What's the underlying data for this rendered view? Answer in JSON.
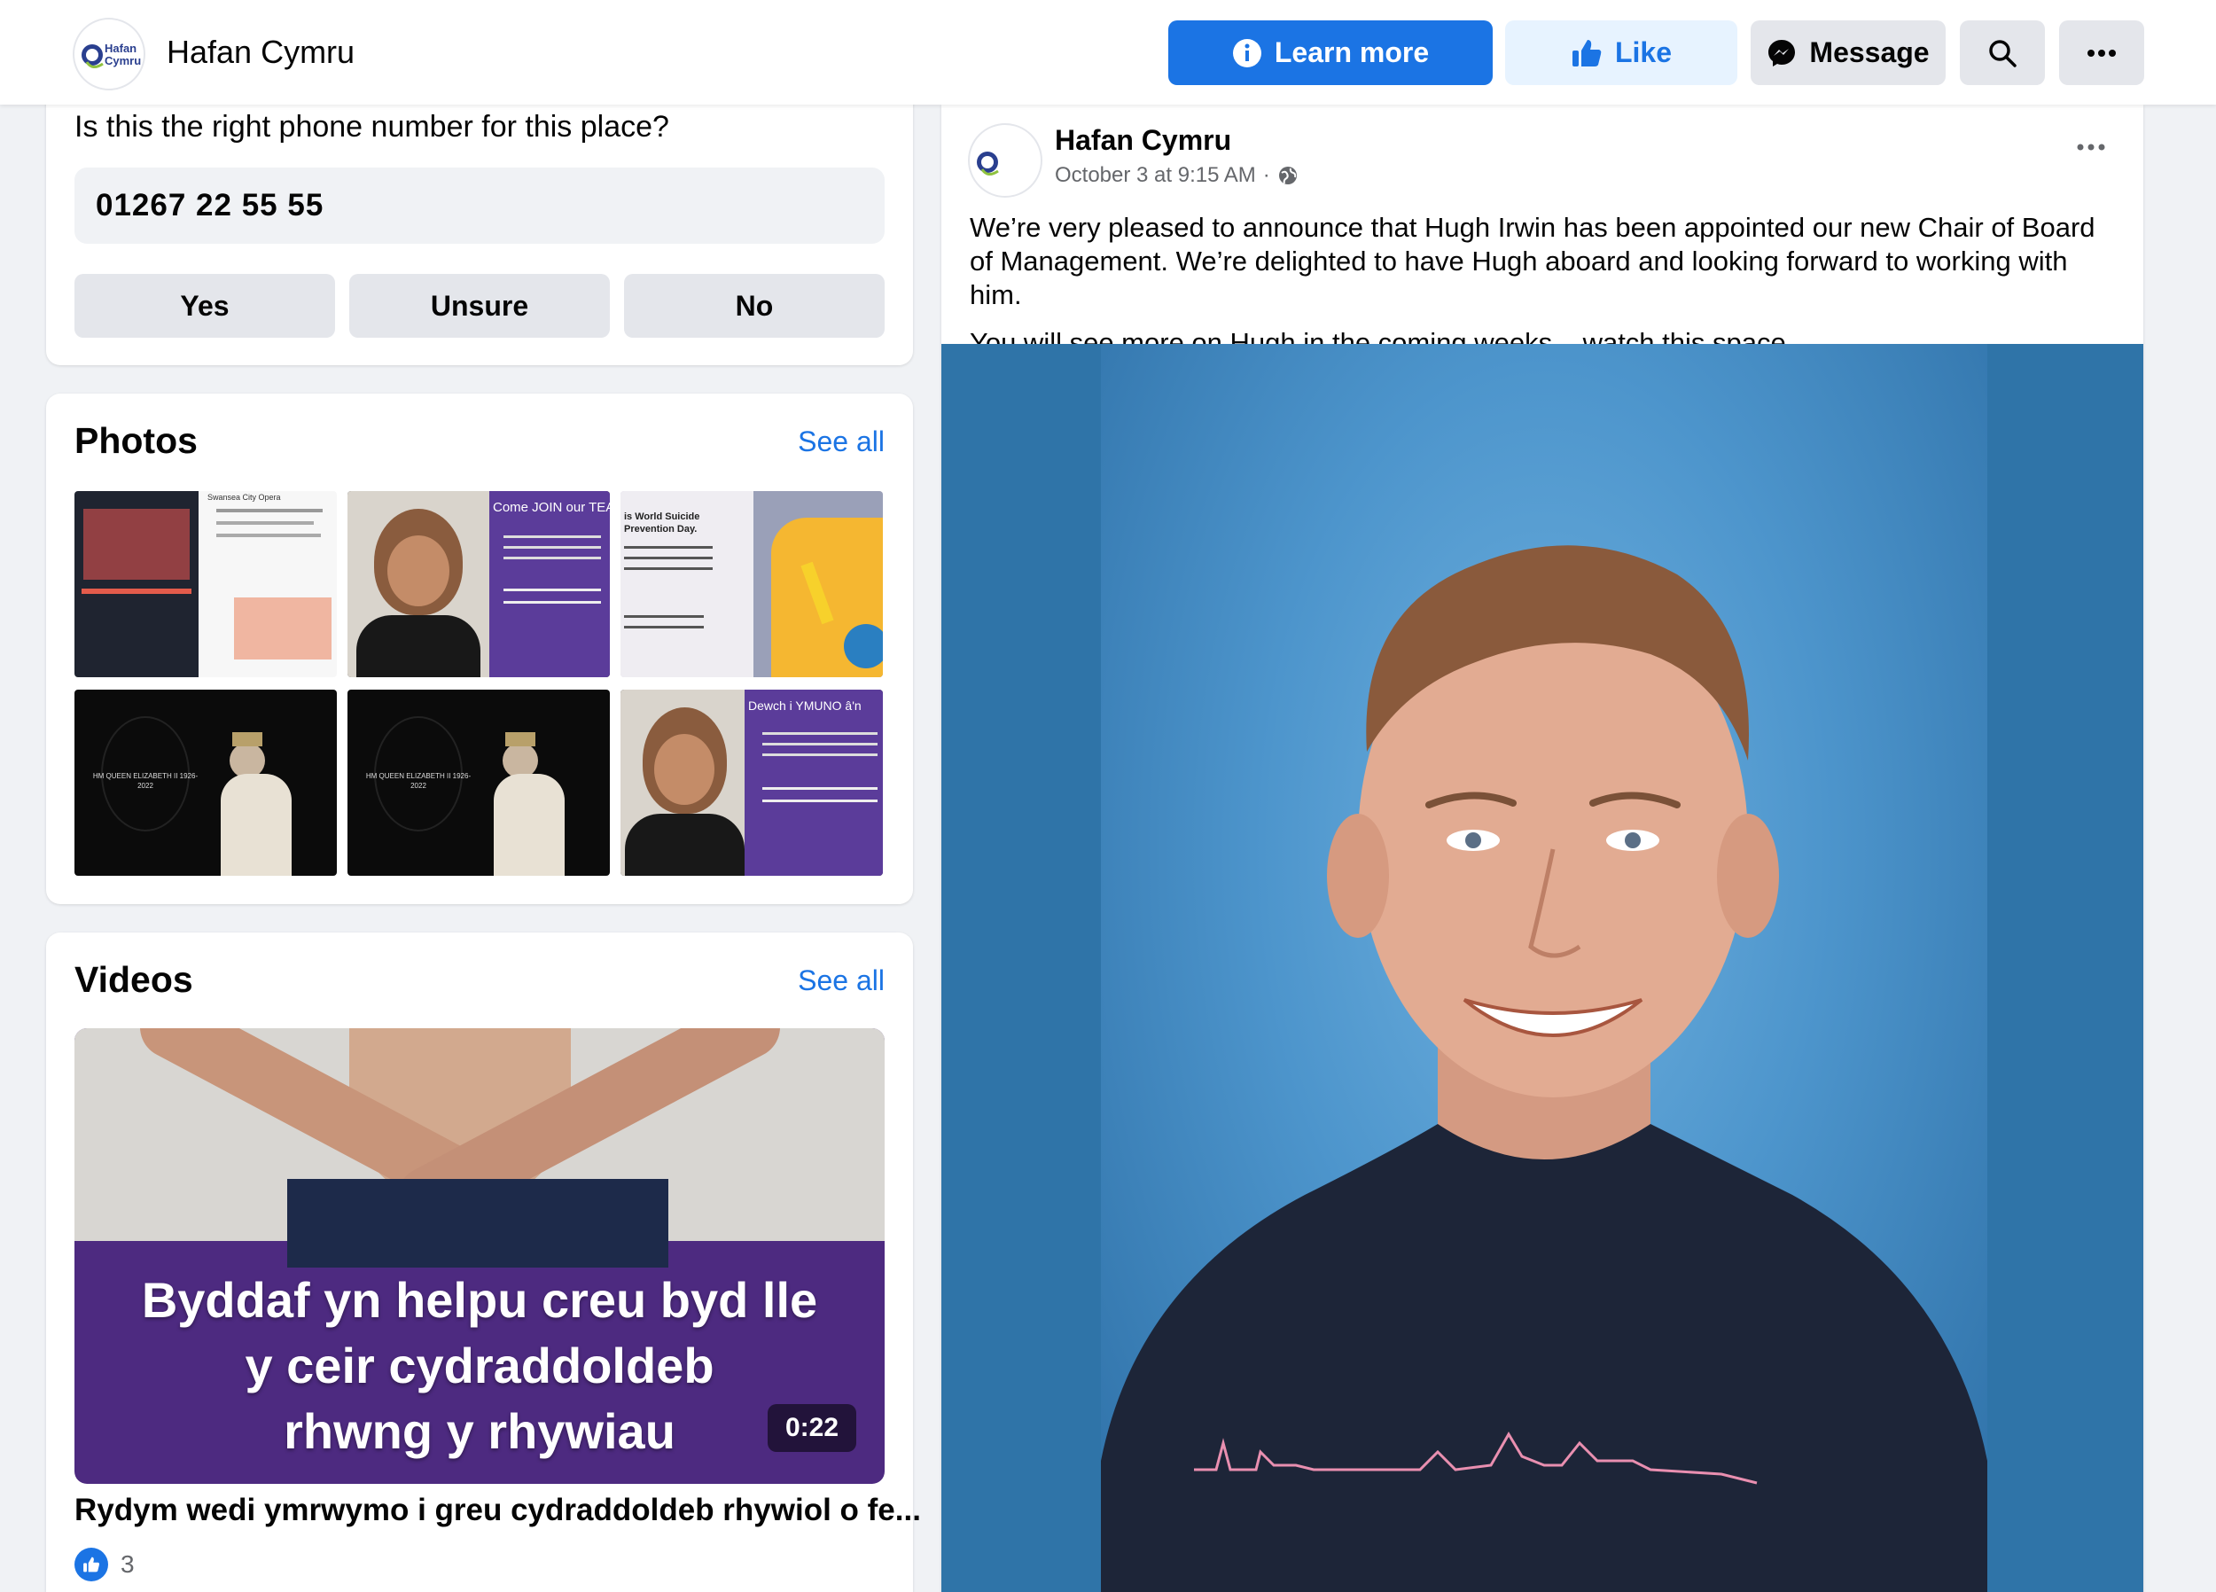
{
  "header": {
    "page_name": "Hafan Cymru",
    "logo_text": "Hafan Cymru",
    "learn_more_label": "Learn more",
    "like_label": "Like",
    "message_label": "Message"
  },
  "phone_card": {
    "question": "Is this the right phone number for this place?",
    "phone_number": "01267 22 55 55",
    "answers": [
      "Yes",
      "Unsure",
      "No"
    ]
  },
  "photos": {
    "title": "Photos",
    "see_all": "See all",
    "thumbs": [
      {
        "text": "Swansea City Opera"
      },
      {
        "text": "Come JOIN our TEAM"
      },
      {
        "text": "is World Suicide Prevention Day."
      },
      {
        "text": "HM QUEEN ELIZABETH II 1926-2022"
      },
      {
        "text": "HM QUEEN ELIZABETH II 1926-2022"
      },
      {
        "text": "Dewch i YMUNO â'n"
      }
    ]
  },
  "videos": {
    "title": "Videos",
    "see_all": "See all",
    "caption_lines": [
      "Byddaf yn helpu creu byd lle",
      "y ceir cydraddoldeb",
      "rhwng y rhywiau"
    ],
    "duration": "0:22",
    "video_title": "Rydym wedi ymrwymo i greu cydraddoldeb rhywiol o fe...",
    "reaction_count": "3"
  },
  "post": {
    "author": "Hafan Cymru",
    "timestamp": "October 3 at 9:15 AM",
    "separator": "·",
    "paragraphs": [
      "We’re very pleased to announce that Hugh Irwin has been appointed our new Chair of Board of Management. We’re delighted to have Hugh aboard and looking forward to working with him.",
      "You will see more on Hugh in the coming weeks – watch this space."
    ]
  },
  "colors": {
    "accent": "#1b74e4",
    "accent_light": "#e7f3ff",
    "button_gray": "#e4e6eb",
    "page_bg": "#f0f2f5",
    "photo_bg": "#2f74a8",
    "video_bg": "#4d2a80"
  },
  "icons": [
    "info-icon",
    "thumbs-up-icon",
    "messenger-icon",
    "search-icon",
    "more-horizontal-icon",
    "globe-icon",
    "like-reaction-icon"
  ]
}
